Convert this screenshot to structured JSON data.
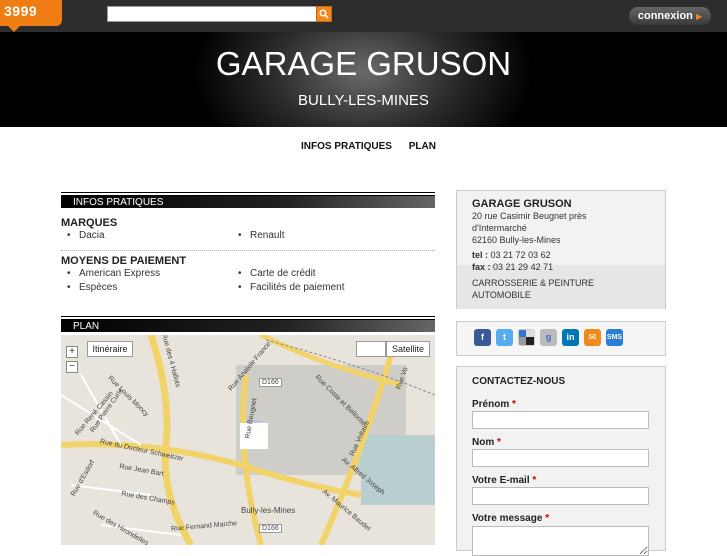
{
  "topbar": {
    "logo": "3999",
    "search_placeholder": "",
    "connexion_label": "connexion"
  },
  "banner": {
    "title": "GARAGE GRUSON",
    "subtitle": "BULLY-LES-MINES"
  },
  "nav": {
    "items": [
      "INFOS PRATIQUES",
      "PLAN"
    ]
  },
  "infos": {
    "section_title": "INFOS PRATIQUES",
    "marques_label": "MARQUES",
    "marques": [
      "Dacia",
      "Renault"
    ],
    "paiement_label": "MOYENS DE PAIEMENT",
    "paiement": [
      "American Express",
      "Carte de crédit",
      "Espèces",
      "Facilités de paiement"
    ]
  },
  "plan": {
    "section_title": "PLAN",
    "itineraire": "Itinéraire",
    "satellite": "Satellite",
    "zoom_in": "+",
    "zoom_out": "−",
    "labels": [
      "Rue des 4 Hallots",
      "Rue Anatole France",
      "Rue Louis Moncy",
      "Rue Pierre Curie",
      "Rue René Cassin",
      "Rue du Docteur Schweitzer",
      "Rue Jean Bart",
      "Rue d'Esdorf",
      "Rue des Champs",
      "Rue Fernand Marche",
      "Rue des Hirondelles",
      "Rue Beugnet",
      "Rue Coste et Bellonte",
      "Rue Voltaire",
      "Av. Alfred Joseph",
      "Av. Maurice Baudet",
      "D166",
      "D166",
      "Bully-les-Mines",
      "Rue Vo"
    ]
  },
  "contact_card": {
    "name": "GARAGE GRUSON",
    "address1": "20 rue Casimir Beugnet près",
    "address2": "d'Intermarché",
    "address3": "62160 Bully-les-Mines",
    "tel_label": "tel :",
    "tel": "03 21 72 03 62",
    "fax_label": "fax :",
    "fax": "03 21 29 42 71",
    "activity1": "CARROSSERIE & PEINTURE",
    "activity2": "AUTOMOBILE"
  },
  "social": {
    "icons": [
      "facebook-icon",
      "twitter-icon",
      "delicious-icon",
      "google-icon",
      "linkedin-icon",
      "email-icon",
      "sms-icon"
    ],
    "sms_text": "SMS"
  },
  "contact_form": {
    "title": "CONTACTEZ-NOUS",
    "prenom_label": "Prénom",
    "nom_label": "Nom",
    "email_label": "Votre E-mail",
    "message_label": "Votre message",
    "required": "*"
  },
  "colors": {
    "accent": "#f07d14",
    "dark": "#000000"
  }
}
